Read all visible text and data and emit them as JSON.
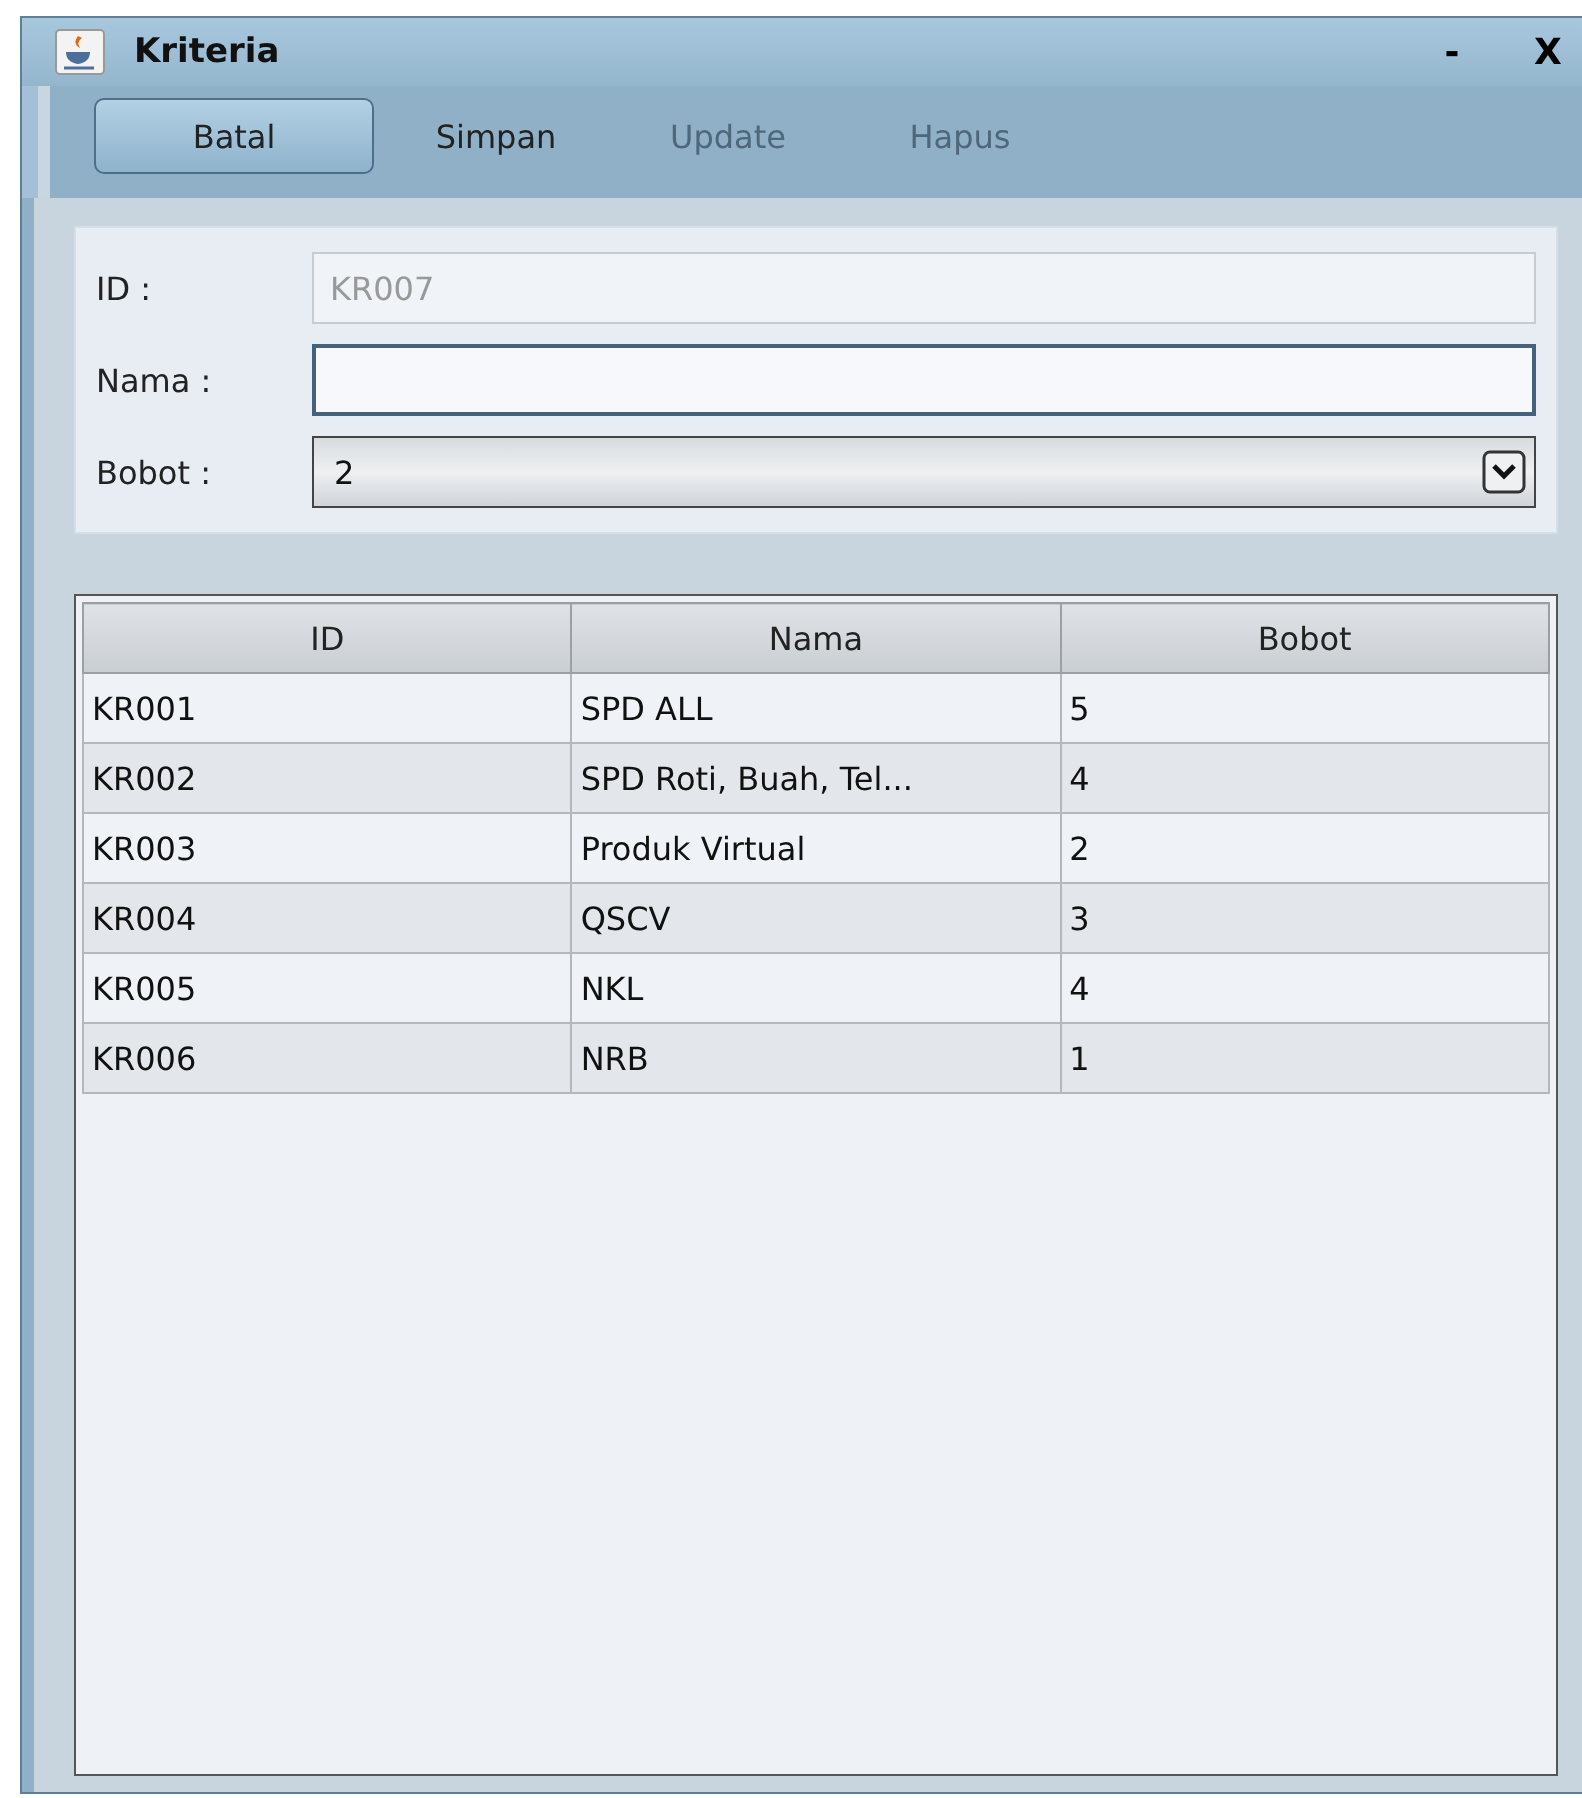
{
  "window": {
    "title": "Kriteria",
    "controls": [
      "-",
      "X"
    ]
  },
  "toolbar": [
    {
      "label": "Batal",
      "selected": true,
      "disabled": false
    },
    {
      "label": "Simpan",
      "selected": false,
      "disabled": false
    },
    {
      "label": "Update",
      "selected": false,
      "disabled": true
    },
    {
      "label": "Hapus",
      "selected": false,
      "disabled": true
    }
  ],
  "form": {
    "fields": [
      {
        "kind": "text",
        "label": "ID :",
        "value": "KR007",
        "disabled": true,
        "focused": false
      },
      {
        "kind": "text",
        "label": "Nama :",
        "disabled": false,
        "focused": true
      },
      {
        "kind": "combo",
        "label": "Bobot :",
        "value": "2",
        "disabled": false,
        "focused": false
      }
    ]
  },
  "table": {
    "columns": [
      "ID",
      "Nama",
      "Bobot"
    ],
    "rows": [
      [
        "KR001",
        "SPD ALL",
        "5"
      ],
      [
        "KR002",
        "SPD Roti, Buah, Tel...",
        "4"
      ],
      [
        "KR003",
        "Produk Virtual",
        "2"
      ],
      [
        "KR004",
        "QSCV",
        "3"
      ],
      [
        "KR005",
        "NKL",
        "4"
      ],
      [
        "KR006",
        "NRB",
        "1"
      ]
    ]
  }
}
